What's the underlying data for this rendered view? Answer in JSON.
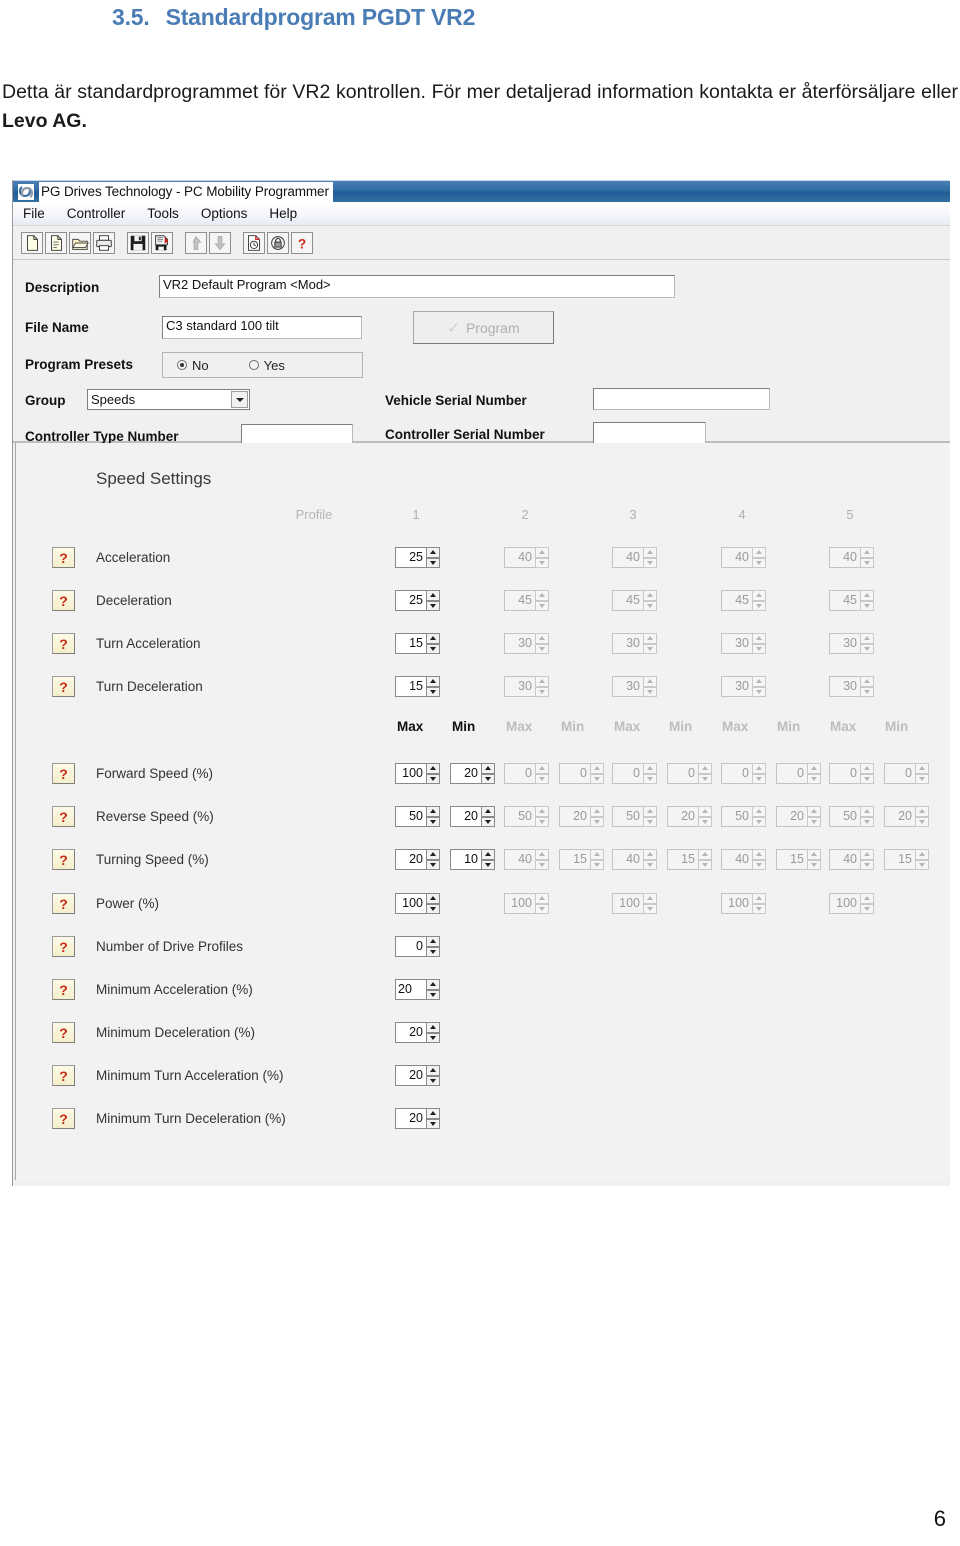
{
  "document": {
    "heading_number": "3.5.",
    "heading_text": "Standardprogram PGDT VR2",
    "paragraph_1": "Detta är standardprogrammet för VR2 kontrollen. För mer detaljerad information kontakta er återförsäljare eller ",
    "paragraph_bold": "Levo AG.",
    "page_number": "6",
    "heading_color": "#4a7cb5"
  },
  "app": {
    "title": "PG Drives Technology - PC Mobility Programmer",
    "menu": [
      "File",
      "Controller",
      "Tools",
      "Options",
      "Help"
    ],
    "toolbar_icons": [
      "new-document-icon",
      "open-document-icon",
      "open-folder-icon",
      "print-icon",
      "save-icon",
      "save-as-icon",
      "upload-arrow-icon",
      "download-arrow-icon",
      "history-icon",
      "lock-icon",
      "help-question-icon"
    ]
  },
  "form": {
    "description_label": "Description",
    "description_value": "VR2 Default Program <Mod>",
    "filename_label": "File Name",
    "filename_value": "C3 standard 100 tilt",
    "program_button": "Program",
    "presets_label": "Program Presets",
    "presets_options": [
      "No",
      "Yes"
    ],
    "presets_selected": "No",
    "group_label": "Group",
    "group_value": "Speeds",
    "controller_type_label": "Controller Type Number",
    "controller_type_value": "",
    "vehicle_serial_label": "Vehicle Serial Number",
    "vehicle_serial_value": "",
    "controller_serial_label": "Controller Serial Number",
    "controller_serial_value": ""
  },
  "settings": {
    "panel_title": "Speed Settings",
    "profile_label": "Profile",
    "profile_columns": [
      "1",
      "2",
      "3",
      "4",
      "5"
    ],
    "maxmin_labels": [
      "Max",
      "Min",
      "Max",
      "Min",
      "Max",
      "Min",
      "Max",
      "Min",
      "Max",
      "Min"
    ],
    "single_rows": [
      {
        "label": "Acceleration",
        "values": [
          "25",
          "40",
          "40",
          "40",
          "40"
        ]
      },
      {
        "label": "Deceleration",
        "values": [
          "25",
          "45",
          "45",
          "45",
          "45"
        ]
      },
      {
        "label": "Turn Acceleration",
        "values": [
          "15",
          "30",
          "30",
          "30",
          "30"
        ]
      },
      {
        "label": "Turn Deceleration",
        "values": [
          "15",
          "30",
          "30",
          "30",
          "30"
        ]
      }
    ],
    "maxmin_rows": [
      {
        "label": "Forward Speed (%)",
        "values": [
          "100",
          "20",
          "0",
          "0",
          "0",
          "0",
          "0",
          "0",
          "0",
          "0"
        ]
      },
      {
        "label": "Reverse Speed (%)",
        "values": [
          "50",
          "20",
          "50",
          "20",
          "50",
          "20",
          "50",
          "20",
          "50",
          "20"
        ]
      },
      {
        "label": "Turning Speed (%)",
        "values": [
          "20",
          "10",
          "40",
          "15",
          "40",
          "15",
          "40",
          "15",
          "40",
          "15"
        ]
      }
    ],
    "power_row": {
      "label": "Power (%)",
      "values": [
        "100",
        "100",
        "100",
        "100",
        "100"
      ]
    },
    "solo_rows": [
      {
        "label": "Number of Drive Profiles",
        "value": "0"
      },
      {
        "label": "Minimum Acceleration (%)",
        "value": "20"
      },
      {
        "label": "Minimum Deceleration (%)",
        "value": "20"
      },
      {
        "label": "Minimum Turn Acceleration (%)",
        "value": "20"
      },
      {
        "label": "Minimum Turn Deceleration (%)",
        "value": "20"
      }
    ],
    "help_glyph": "?"
  }
}
